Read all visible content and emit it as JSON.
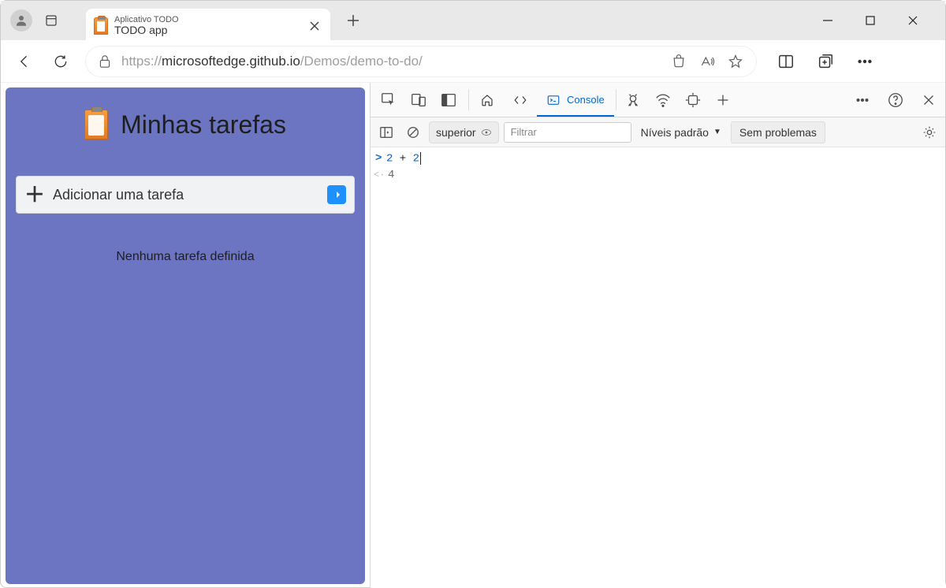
{
  "tab": {
    "subtitle": "Aplicativo TODO",
    "title": "TODO app"
  },
  "address": {
    "scheme_host": "https://",
    "highlight": "microsoftedge.github.io",
    "path": "/Demos/demo-to-do/"
  },
  "page": {
    "title": "Minhas tarefas",
    "input_placeholder": "Adicionar uma tarefa",
    "empty_text": "Nenhuma tarefa definida"
  },
  "devtools": {
    "tab_console": "Console",
    "context": "superior",
    "filter_placeholder": "Filtrar",
    "levels": "Níveis padrão",
    "issues": "Sem problemas",
    "input_code_a": "2",
    "input_code_op": " + ",
    "input_code_b": "2",
    "output": "4"
  }
}
